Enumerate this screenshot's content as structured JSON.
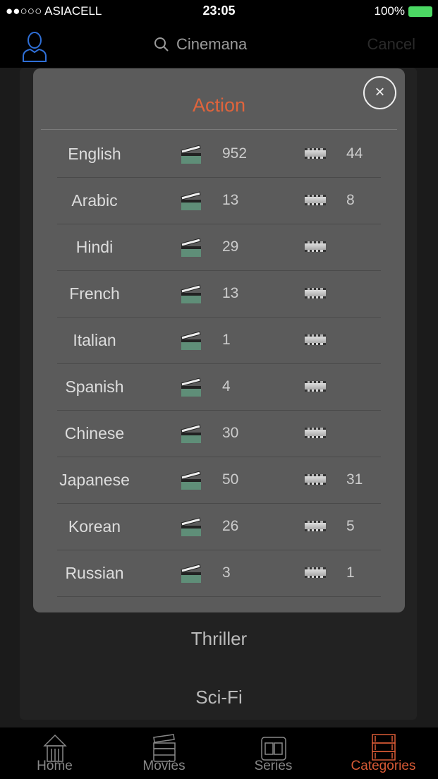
{
  "status": {
    "carrier": "●●○○○ ASIACELL",
    "time": "23:05",
    "battery": "100%"
  },
  "nav": {
    "search_placeholder": "Cinemana",
    "cancel": "Cancel"
  },
  "background_list": [
    "Thriller",
    "Sci-Fi"
  ],
  "modal": {
    "title": "Action",
    "close": "×",
    "rows": [
      {
        "lang": "English",
        "movies": "952",
        "series": "44"
      },
      {
        "lang": "Arabic",
        "movies": "13",
        "series": "8"
      },
      {
        "lang": "Hindi",
        "movies": "29",
        "series": ""
      },
      {
        "lang": "French",
        "movies": "13",
        "series": ""
      },
      {
        "lang": "Italian",
        "movies": "1",
        "series": ""
      },
      {
        "lang": "Spanish",
        "movies": "4",
        "series": ""
      },
      {
        "lang": "Chinese",
        "movies": "30",
        "series": ""
      },
      {
        "lang": "Japanese",
        "movies": "50",
        "series": "31"
      },
      {
        "lang": "Korean",
        "movies": "26",
        "series": "5"
      },
      {
        "lang": "Russian",
        "movies": "3",
        "series": "1"
      }
    ]
  },
  "tabs": [
    {
      "label": "Home"
    },
    {
      "label": "Movies"
    },
    {
      "label": "Series"
    },
    {
      "label": "Categories"
    }
  ],
  "colors": {
    "accent": "#e0643c",
    "avatar": "#2f6fd6"
  }
}
